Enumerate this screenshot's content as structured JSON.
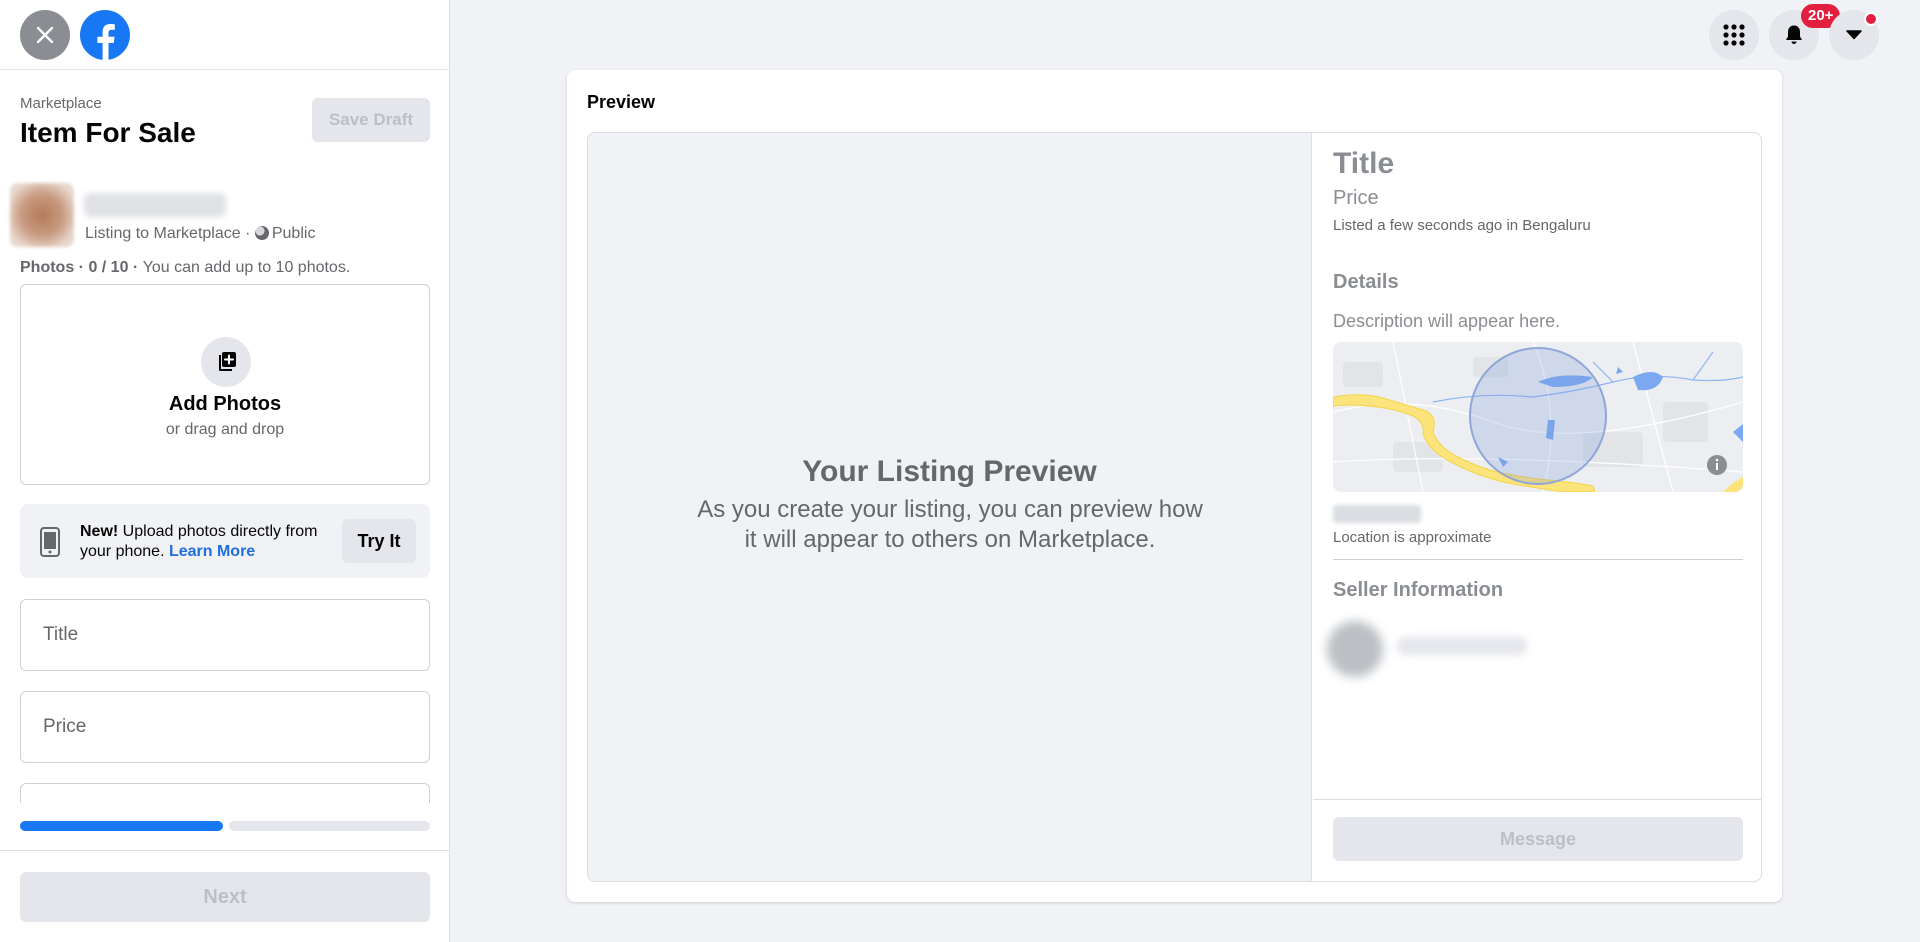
{
  "header": {
    "close_icon": "close-icon",
    "logo": "facebook-logo",
    "breadcrumb": "Marketplace",
    "title": "Item For Sale",
    "save_draft": "Save Draft"
  },
  "seller": {
    "listing_to": "Listing to Marketplace · ",
    "audience": "Public"
  },
  "photos": {
    "label": "Photos",
    "count": " · 0 / 10 · ",
    "hint": "You can add up to 10 photos.",
    "add_label": "Add Photos",
    "drag_label": "or drag and drop"
  },
  "promo": {
    "new": "New!",
    "text": " Upload photos directly from your phone. ",
    "learn_more": "Learn More",
    "try_it": "Try It"
  },
  "form": {
    "title_placeholder": "Title",
    "price_placeholder": "Price",
    "next": "Next",
    "progress_step": 1,
    "progress_steps_total": 2
  },
  "top_controls": {
    "menu_icon": "grid-menu-icon",
    "notifications_icon": "bell-icon",
    "notif_badge": "20+",
    "account_icon": "caret-down-icon"
  },
  "preview": {
    "heading": "Preview",
    "image_title": "Your Listing Preview",
    "image_desc": "As you create your listing, you can preview how it will appear to others on Marketplace.",
    "title": "Title",
    "price": "Price",
    "listed": "Listed a few seconds ago in Bengaluru",
    "details_heading": "Details",
    "description": "Description will appear here.",
    "location_note": "Location is approximate",
    "seller_heading": "Seller Information",
    "message": "Message"
  },
  "colors": {
    "brand": "#1877f2",
    "badge": "#e41e3f",
    "page_bg": "#f0f2f5"
  }
}
